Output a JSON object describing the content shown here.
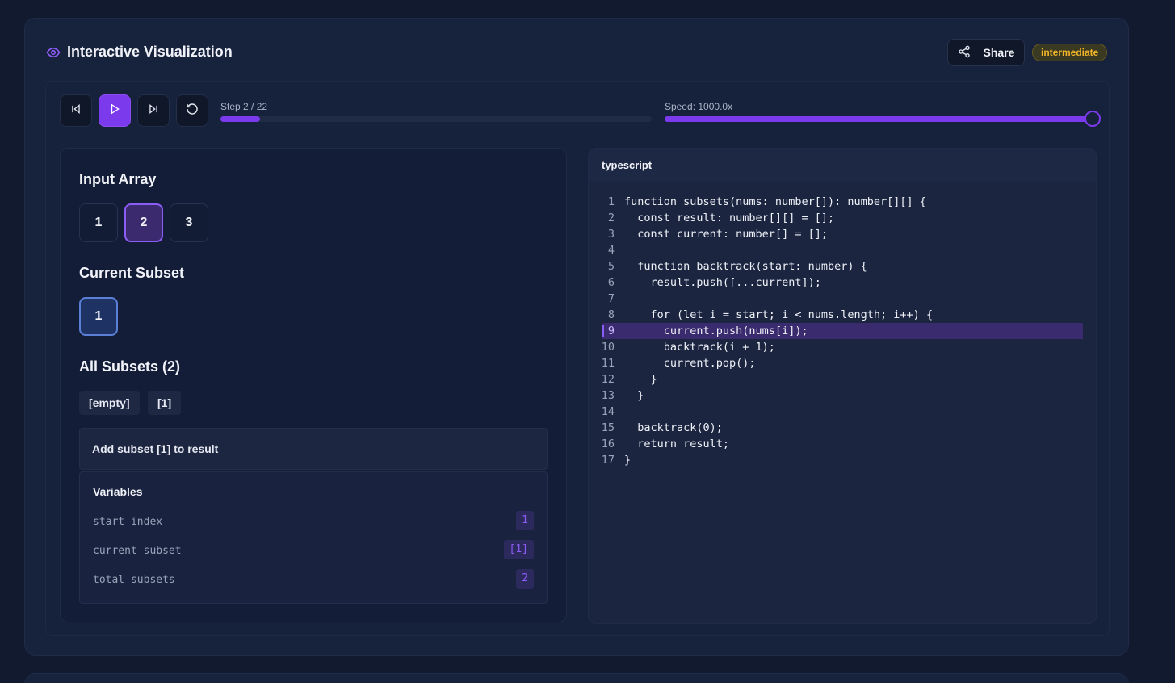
{
  "header": {
    "title": "Interactive Visualization",
    "share_label": "Share",
    "difficulty": "intermediate"
  },
  "controls": {
    "step_label": "Step 2 / 22",
    "step_progress": 0.091,
    "speed_label": "Speed: 1000.0x",
    "speed_progress": 1.0
  },
  "left": {
    "input_title": "Input Array",
    "input_array": [
      "1",
      "2",
      "3"
    ],
    "active_index": 1,
    "subset_title": "Current Subset",
    "current_subset": [
      "1"
    ],
    "all_title": "All Subsets (2)",
    "all_subsets": [
      "[empty]",
      "[1]"
    ],
    "message": "Add subset [1] to result",
    "variables_title": "Variables",
    "variables": [
      {
        "name": "start index",
        "value": "1"
      },
      {
        "name": "current subset",
        "value": "[1]"
      },
      {
        "name": "total subsets",
        "value": "2"
      }
    ]
  },
  "code": {
    "language": "typescript",
    "highlight_line": 9,
    "lines": [
      "function subsets(nums: number[]): number[][] {",
      "  const result: number[][] = [];",
      "  const current: number[] = [];",
      "",
      "  function backtrack(start: number) {",
      "    result.push([...current]);",
      "",
      "    for (let i = start; i < nums.length; i++) {",
      "      current.push(nums[i]);",
      "      backtrack(i + 1);",
      "      current.pop();",
      "    }",
      "  }",
      "",
      "  backtrack(0);",
      "  return result;",
      "}"
    ]
  },
  "colors": {
    "accent": "#7c3aed",
    "badge": "#f0b429"
  }
}
